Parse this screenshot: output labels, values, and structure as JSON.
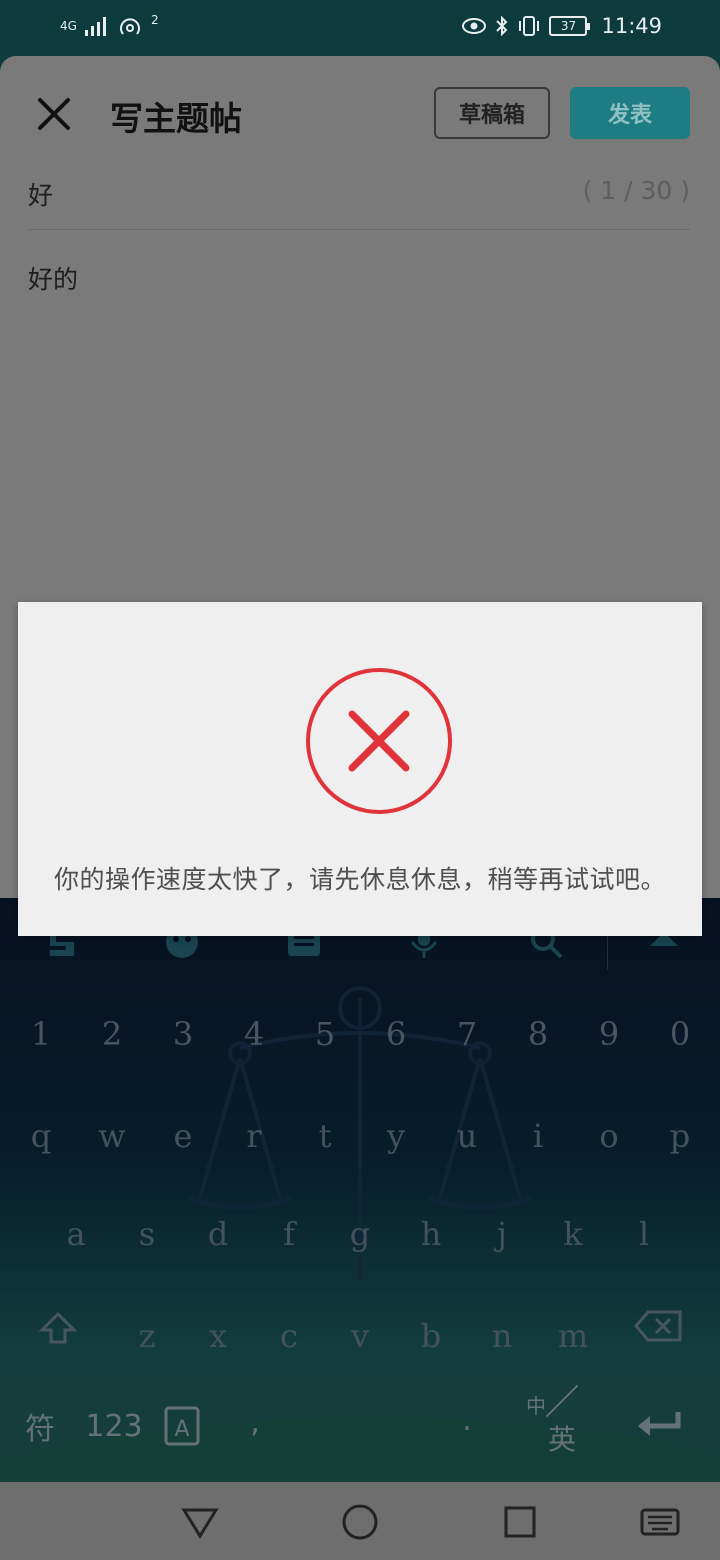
{
  "status_bar": {
    "network": "4G",
    "hotspot_count": "2",
    "battery": "37",
    "time": "11:49"
  },
  "toolbar": {
    "title": "写主题帖",
    "drafts_label": "草稿箱",
    "publish_label": "发表"
  },
  "post": {
    "subject": "好",
    "subject_count": "( 1 / 30 )",
    "body": "好的"
  },
  "toast": {
    "message": "你的操作速度太快了，请先休息休息，稍等再试试吧。",
    "icon": "error-x-icon",
    "accent": "#e0343a"
  },
  "keyboard": {
    "numbers": [
      "1",
      "2",
      "3",
      "4",
      "5",
      "6",
      "7",
      "8",
      "9",
      "0"
    ],
    "row1": [
      "q",
      "w",
      "e",
      "r",
      "t",
      "y",
      "u",
      "i",
      "o",
      "p"
    ],
    "row2": [
      "a",
      "s",
      "d",
      "f",
      "g",
      "h",
      "j",
      "k",
      "l"
    ],
    "row3": [
      "z",
      "x",
      "c",
      "v",
      "b",
      "n",
      "m"
    ],
    "symbols_key": "符",
    "numbers_key": "123",
    "comma_key": ",",
    "period_key": ".",
    "lang_zh": "中",
    "lang_en": "英"
  }
}
